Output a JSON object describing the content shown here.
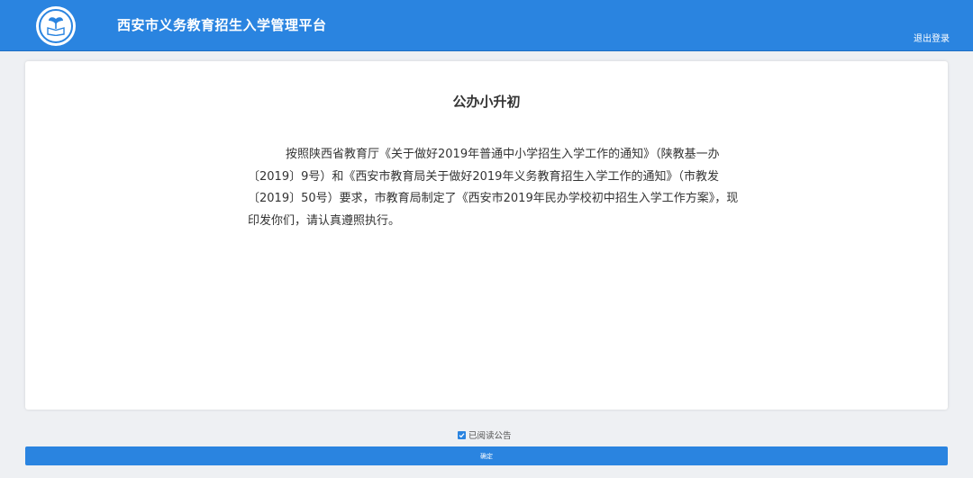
{
  "header": {
    "title": "西安市义务教育招生入学管理平台",
    "logout_label": "退出登录",
    "logo_icon": "school-emblem-icon",
    "background_color": "#2a84e0"
  },
  "notice": {
    "title": "公办小升初",
    "lines": [
      "按照陕西省教育厅《关于做好2019年普通中小学招生入学工作的通知》（陕教基一办",
      "〔2019〕9号）和《西安市教育局关于做好2019年义务教育招生入学工作的通知》（市教发",
      "〔2019〕50号）要求，市教育局制定了《西安市2019年民办学校初中招生入学工作方案》，现",
      "印发你们，请认真遵照执行。"
    ]
  },
  "footer": {
    "read_checkbox_checked": true,
    "read_label": "已阅读公告",
    "confirm_label": "确定"
  }
}
